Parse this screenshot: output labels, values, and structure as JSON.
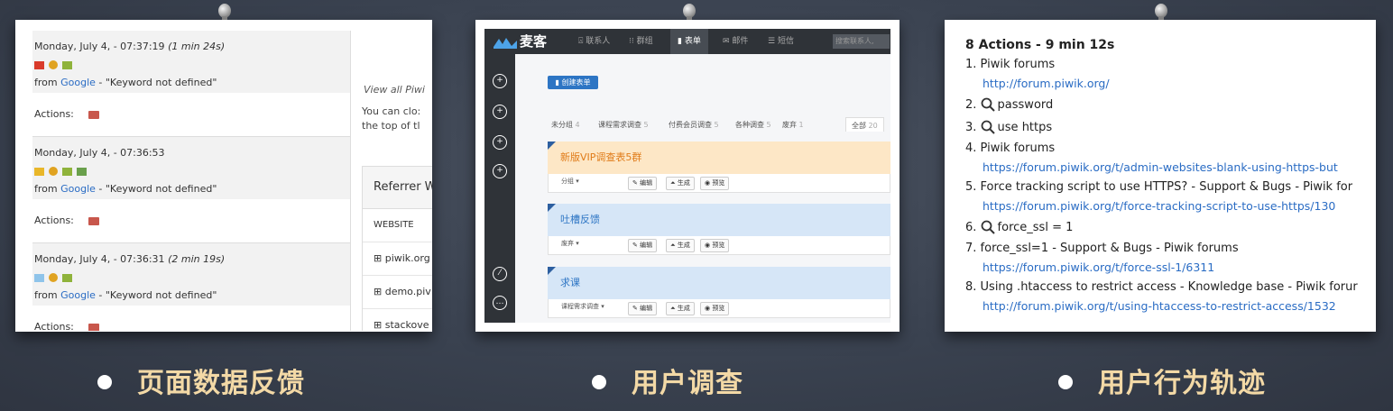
{
  "slides": [
    {
      "caption": "页面数据反馈",
      "visits": [
        {
          "date": "Monday, July 4, - 07:37:19 ",
          "duration": "(1 min 24s)",
          "source_prefix": "from ",
          "engine": "Google",
          "keyword": " - \"Keyword not defined\"",
          "actions_label": "Actions:"
        },
        {
          "date": "Monday, July 4, - 07:36:53",
          "duration": "",
          "source_prefix": "from ",
          "engine": "Google",
          "keyword": " - \"Keyword not defined\"",
          "actions_label": "Actions:"
        },
        {
          "date": "Monday, July 4, - 07:36:31 ",
          "duration": "(2 min 19s)",
          "source_prefix": "from ",
          "engine": "Google",
          "keyword": " - \"Keyword not defined\"",
          "actions_label": "Actions:"
        }
      ],
      "right": {
        "view_all": "View all Piwi",
        "note_line1": "You can clo:",
        "note_line2": "the top of tl",
        "box_title": "Referrer W",
        "column": "WEBSITE",
        "rows": [
          "piwik.org",
          "demo.piv",
          "stackove"
        ]
      }
    },
    {
      "caption": "用户调查",
      "logo": "麦客",
      "nav": [
        "联系人",
        "群组",
        "表单",
        "邮件",
        "短信"
      ],
      "search_placeholder": "搜索联系人,",
      "create_button": "创建表单",
      "tabs": [
        {
          "label": "未分组",
          "count": "4"
        },
        {
          "label": "课程需求调查",
          "count": "5"
        },
        {
          "label": "付费会员调查",
          "count": "5"
        },
        {
          "label": "各种调查",
          "count": "5"
        },
        {
          "label": "废弃",
          "count": "1"
        },
        {
          "label": "全部",
          "count": "20"
        }
      ],
      "forms": [
        {
          "title": "新版VIP调查表5群",
          "group": "分组",
          "color": "#fde7c6",
          "title_color": "#e07b18"
        },
        {
          "title": "吐槽反馈",
          "group": "废弃",
          "color": "#d6e6f7",
          "title_color": "#2d75c4"
        },
        {
          "title": "求课",
          "group": "课程需求调查",
          "color": "#d6e6f7",
          "title_color": "#2d75c4"
        }
      ],
      "buttons": [
        "编辑",
        "生成",
        "预览"
      ]
    },
    {
      "caption": "用户行为轨迹",
      "title": "8 Actions - 9 min 12s",
      "items": [
        {
          "text": "1. Piwik forums",
          "url": "http://forum.piwik.org/",
          "search": false
        },
        {
          "text": "password",
          "num": "2. ",
          "url": "",
          "search": true
        },
        {
          "text": "use https",
          "num": "3. ",
          "url": "",
          "search": true
        },
        {
          "text": "4. Piwik forums",
          "url": "https://forum.piwik.org/t/admin-websites-blank-using-https-but",
          "search": false
        },
        {
          "text": "5. Force tracking script to use HTTPS? - Support & Bugs - Piwik for",
          "url": "https://forum.piwik.org/t/force-tracking-script-to-use-https/130",
          "search": false
        },
        {
          "text": "force_ssl = 1",
          "num": "6. ",
          "url": "",
          "search": true
        },
        {
          "text": "7. force_ssl=1 - Support & Bugs - Piwik forums",
          "url": "https://forum.piwik.org/t/force-ssl-1/6311",
          "search": false
        },
        {
          "text": "8. Using .htaccess to restrict access - Knowledge base - Piwik forur",
          "url": "http://forum.piwik.org/t/using-htaccess-to-restrict-access/1532",
          "search": false
        }
      ]
    }
  ]
}
